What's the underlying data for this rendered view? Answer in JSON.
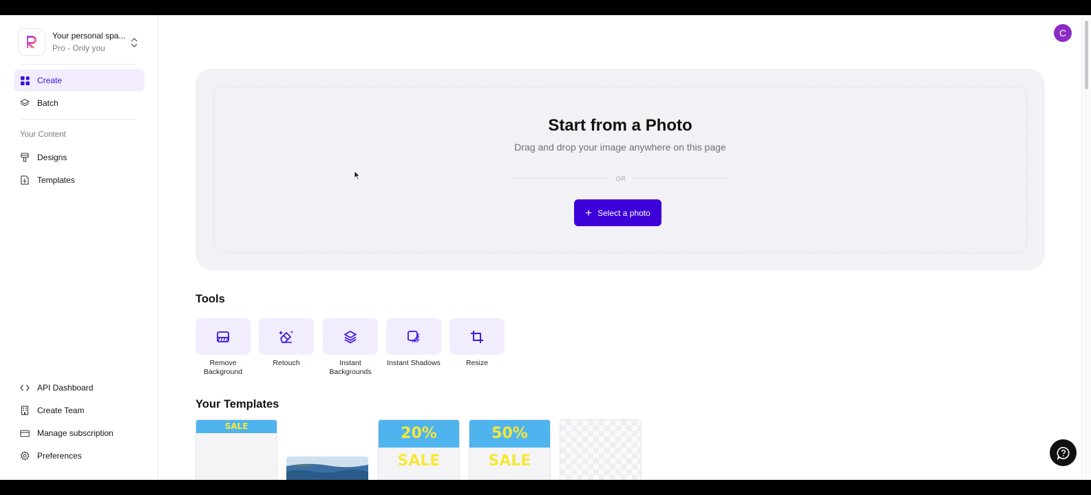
{
  "workspace": {
    "title": "Your personal spa...",
    "subtitle": "Pro - Only you"
  },
  "nav": {
    "primary": [
      {
        "label": "Create",
        "icon": "grid-icon",
        "active": true
      },
      {
        "label": "Batch",
        "icon": "layers-icon",
        "active": false
      }
    ],
    "content_section_label": "Your Content",
    "content": [
      {
        "label": "Designs",
        "icon": "brush-icon"
      },
      {
        "label": "Templates",
        "icon": "template-file-icon"
      }
    ],
    "bottom": [
      {
        "label": "API Dashboard",
        "icon": "code-icon"
      },
      {
        "label": "Create Team",
        "icon": "building-icon"
      },
      {
        "label": "Manage subscription",
        "icon": "credit-card-icon"
      },
      {
        "label": "Preferences",
        "icon": "gear-icon"
      }
    ]
  },
  "user": {
    "avatar_initial": "C",
    "avatar_color": "#8c2cc7"
  },
  "upload": {
    "title": "Start from a Photo",
    "subtitle": "Drag and drop your image anywhere on this page",
    "or_text": "OR",
    "button_label": "Select a photo"
  },
  "tools": {
    "heading": "Tools",
    "items": [
      {
        "label": "Remove Background",
        "icon": "remove-background-icon"
      },
      {
        "label": "Retouch",
        "icon": "eraser-icon"
      },
      {
        "label": "Instant Backgrounds",
        "icon": "stack-icon"
      },
      {
        "label": "Instant Shadows",
        "icon": "shadow-icon"
      },
      {
        "label": "Resize",
        "icon": "crop-icon"
      }
    ]
  },
  "templates": {
    "heading": "Your Templates",
    "items": [
      {
        "banner": "SALE"
      },
      {
        "banner": ""
      },
      {
        "banner": "20% SALE"
      },
      {
        "banner": "50% SALE"
      },
      {
        "banner": ""
      }
    ]
  },
  "colors": {
    "accent": "#3d00d8",
    "active_nav_bg": "#f1edff",
    "tool_bg": "#f1edff",
    "banner_blue": "#4fb3ee",
    "banner_yellow": "#f6e73a"
  }
}
